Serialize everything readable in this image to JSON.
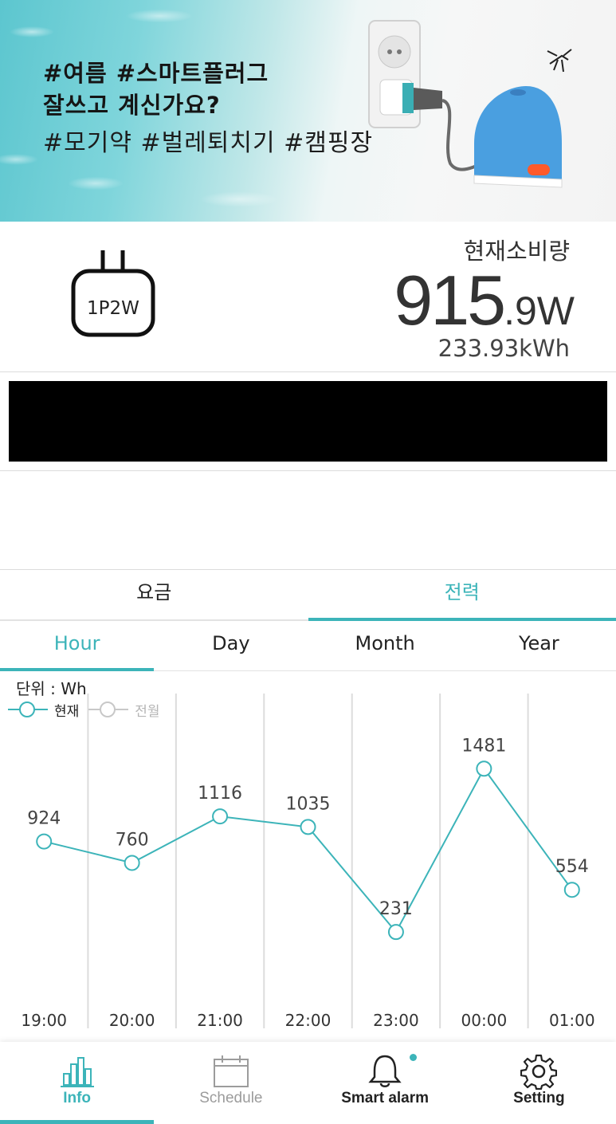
{
  "banner": {
    "line1": "#여름  #스마트플러그",
    "line2": "잘쓰고 계신가요?",
    "line3": "#모기약  #벌레퇴치기  #캠핑장"
  },
  "device": {
    "type_label": "1P2W",
    "usage_label": "현재소비량",
    "usage_int": "915",
    "usage_dec": ".9W",
    "usage_total": "233.93kWh"
  },
  "main_tabs": [
    {
      "label": "요금",
      "active": false
    },
    {
      "label": "전력",
      "active": true
    }
  ],
  "sub_tabs": [
    {
      "label": "Hour",
      "active": true
    },
    {
      "label": "Day",
      "active": false
    },
    {
      "label": "Month",
      "active": false
    },
    {
      "label": "Year",
      "active": false
    }
  ],
  "chart": {
    "unit_label": "단위 : Wh",
    "legend": [
      {
        "label": "현재",
        "color": "#3cb4b9"
      },
      {
        "label": "전월",
        "color": "#c8c8c8"
      }
    ]
  },
  "chart_data": {
    "type": "line",
    "x": [
      "19:00",
      "20:00",
      "21:00",
      "22:00",
      "23:00",
      "00:00",
      "01:00"
    ],
    "series": [
      {
        "name": "현재",
        "values": [
          924,
          760,
          1116,
          1035,
          231,
          1481,
          554
        ]
      }
    ],
    "ylabel": "단위 : Wh",
    "legend": [
      "현재",
      "전월"
    ],
    "grid": true
  },
  "nav": [
    {
      "label": "Info",
      "icon": "bar-chart-icon",
      "active": true
    },
    {
      "label": "Schedule",
      "icon": "calendar-icon",
      "disabled": true
    },
    {
      "label": "Smart alarm",
      "icon": "bell-icon"
    },
    {
      "label": "Setting",
      "icon": "gear-icon"
    }
  ],
  "colors": {
    "accent": "#3cb4b9"
  }
}
